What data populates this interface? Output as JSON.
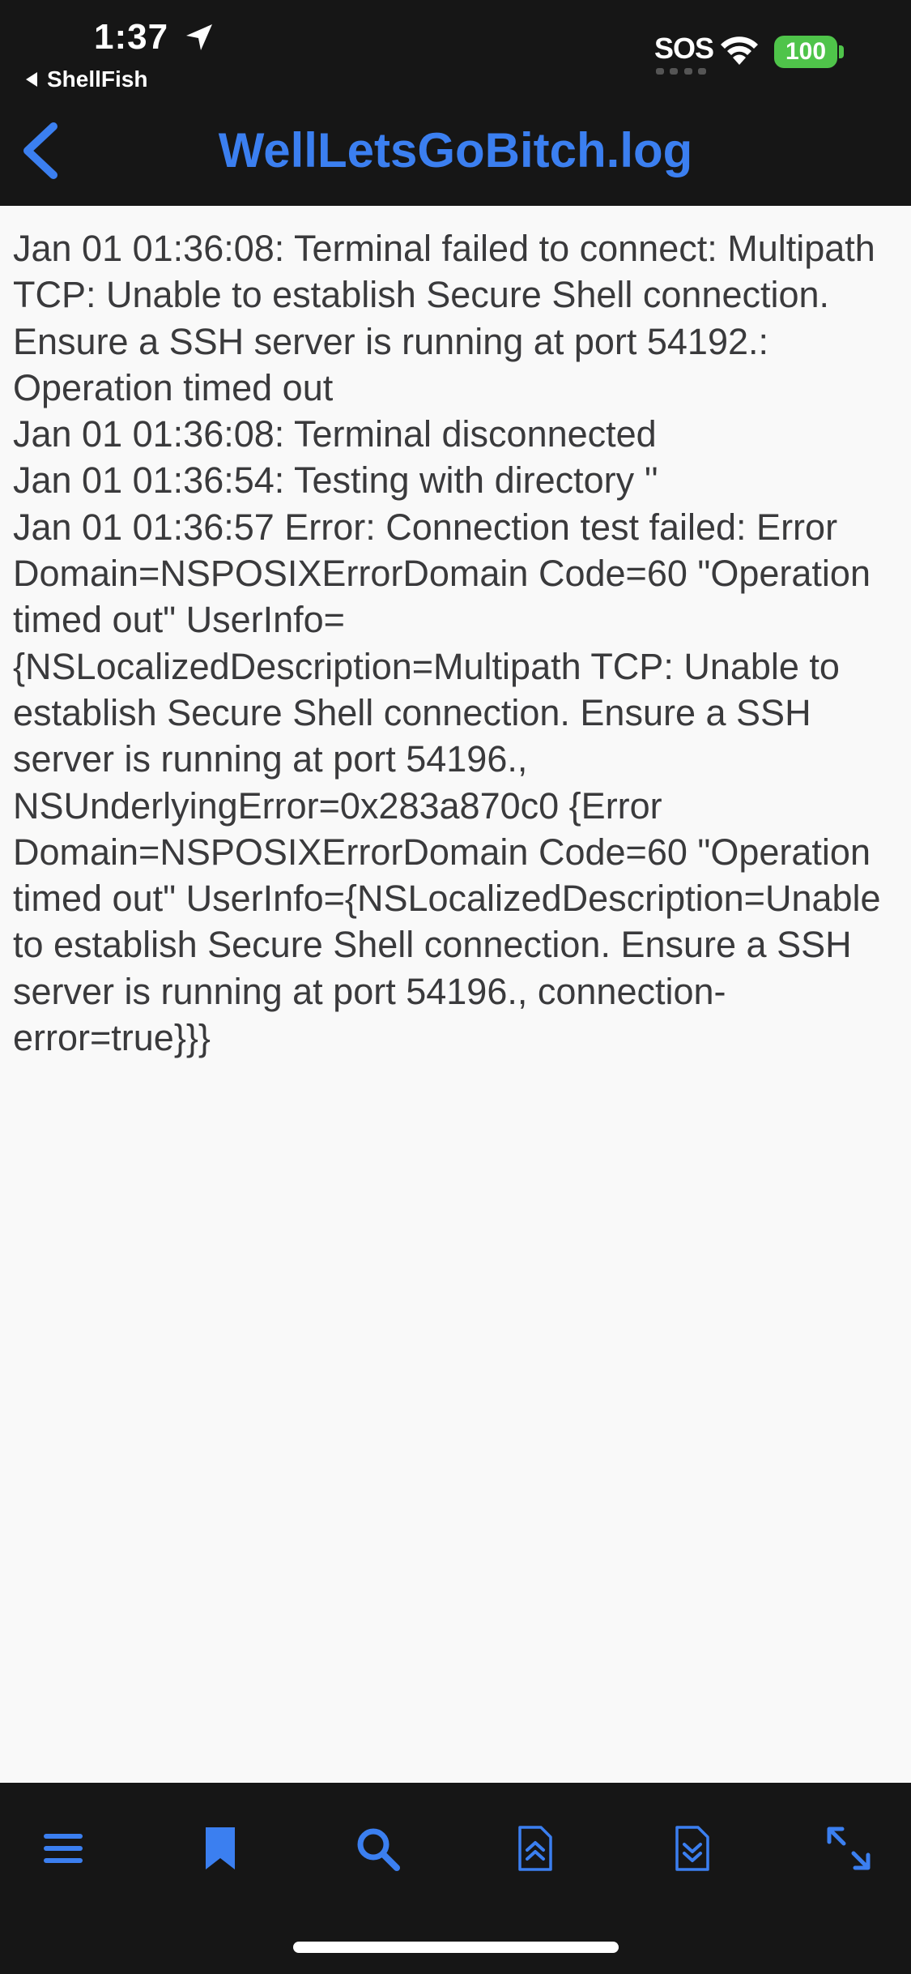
{
  "status_bar": {
    "time": "1:37",
    "back_app": "ShellFish",
    "sos": "SOS",
    "battery": "100"
  },
  "nav": {
    "title": "WellLetsGoBitch.log"
  },
  "log": {
    "lines": [
      "Jan 01 01:36:08: Terminal failed to connect: Multipath TCP: Unable to establish Secure Shell connection. Ensure a SSH server is running at port 54192.: Operation timed out",
      "Jan 01 01:36:08: Terminal disconnected",
      "Jan 01 01:36:54: Testing with directory ''",
      "Jan 01 01:36:57 Error: Connection test failed: Error Domain=NSPOSIXErrorDomain Code=60 \"Operation timed out\" UserInfo={NSLocalizedDescription=Multipath TCP: Unable to establish Secure Shell connection. Ensure a SSH server is running at port 54196., NSUnderlyingError=0x283a870c0 {Error Domain=NSPOSIXErrorDomain Code=60 \"Operation timed out\" UserInfo={NSLocalizedDescription=Unable to establish Secure Shell connection. Ensure a SSH server is running at port 54196., connection-error=true}}}"
    ]
  },
  "toolbar": {
    "icons": [
      "menu-icon",
      "bookmark-icon",
      "search-icon",
      "scroll-top-icon",
      "scroll-bottom-icon",
      "expand-icon"
    ]
  },
  "colors": {
    "accent": "#3b7ff0",
    "header_bg": "#161616",
    "content_bg": "#f9f9f9",
    "text": "#3a3a3c",
    "battery": "#4fc44a"
  }
}
